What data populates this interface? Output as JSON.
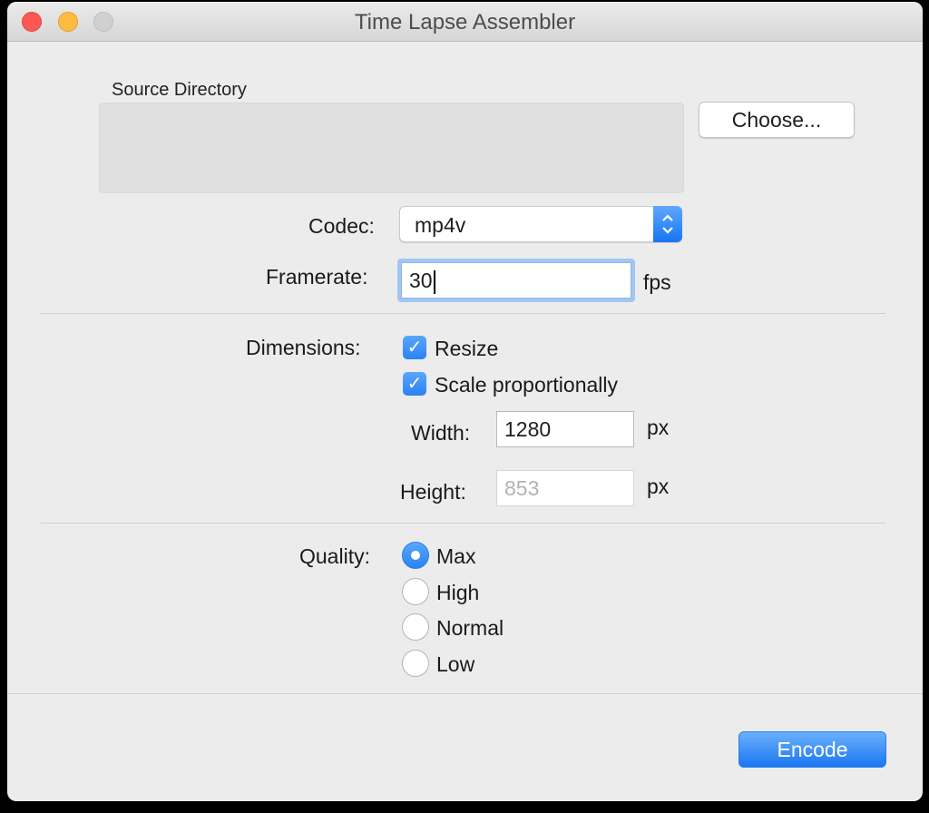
{
  "window": {
    "title": "Time Lapse Assembler",
    "controls": [
      "close",
      "minimize",
      "zoom"
    ]
  },
  "source": {
    "label": "Source Directory",
    "path": "",
    "choose_label": "Choose..."
  },
  "codec": {
    "label": "Codec:",
    "value": "mp4v"
  },
  "framerate": {
    "label": "Framerate:",
    "value": "30",
    "unit": "fps"
  },
  "dimensions": {
    "label": "Dimensions:",
    "resize": {
      "label": "Resize",
      "checked": true
    },
    "scale": {
      "label": "Scale proportionally",
      "checked": true
    },
    "width": {
      "label": "Width:",
      "value": "1280",
      "unit": "px"
    },
    "height": {
      "label": "Height:",
      "value": "853",
      "unit": "px",
      "disabled": true
    }
  },
  "quality": {
    "label": "Quality:",
    "selected": "Max",
    "options": [
      "Max",
      "High",
      "Normal",
      "Low"
    ]
  },
  "actions": {
    "encode_label": "Encode"
  },
  "colors": {
    "accent": "#2a82f3",
    "focus_ring": "#a2c6f3"
  }
}
